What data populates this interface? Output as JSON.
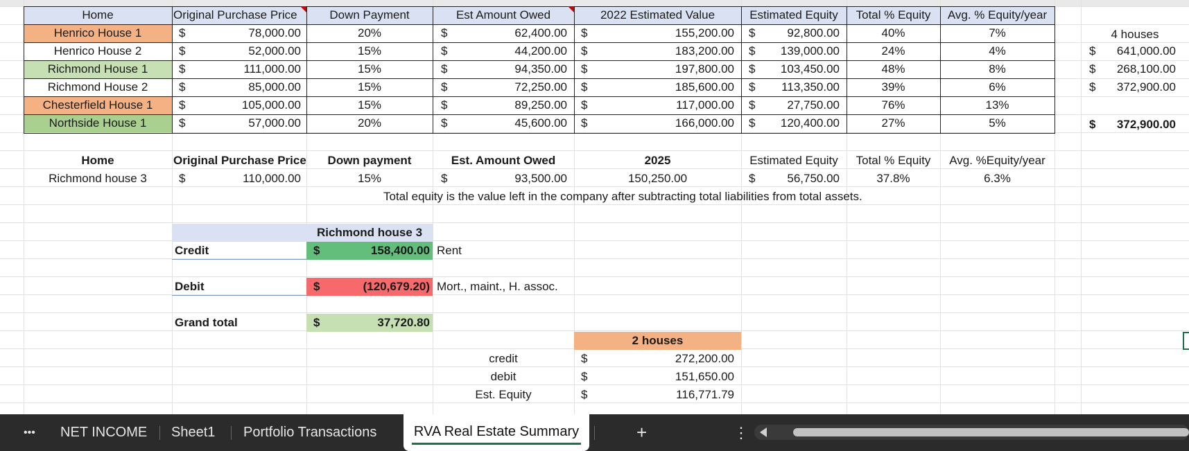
{
  "colors": {
    "header_blue": "#d9e1f2",
    "row_orange": "#f4b183",
    "row_lightgreen": "#c6e0b4",
    "row_green": "#a9d08e",
    "credit_green": "#63be7b",
    "debit_red": "#f8696b",
    "grand_green": "#c6e0b4",
    "tabbar_bg": "#2b2b2b",
    "active_tab_underline": "#1e7145"
  },
  "table1": {
    "headers": [
      "Home",
      "Original Purchase Price",
      "Down Payment",
      "Est Amount Owed",
      "2022 Estimated Value",
      "Estimated Equity",
      "Total % Equity",
      "Avg. % Equity/year"
    ],
    "rows": [
      {
        "home": "Henrico House 1",
        "price": "78,000.00",
        "down": "20%",
        "owed": "62,400.00",
        "value": "155,200.00",
        "equity": "92,800.00",
        "total_pct": "40%",
        "avg_pct": "7%"
      },
      {
        "home": "Henrico House 2",
        "price": "52,000.00",
        "down": "15%",
        "owed": "44,200.00",
        "value": "183,200.00",
        "equity": "139,000.00",
        "total_pct": "24%",
        "avg_pct": "4%"
      },
      {
        "home": "Richmond House 1",
        "price": "111,000.00",
        "down": "15%",
        "owed": "94,350.00",
        "value": "197,800.00",
        "equity": "103,450.00",
        "total_pct": "48%",
        "avg_pct": "8%"
      },
      {
        "home": "Richmond House 2",
        "price": "85,000.00",
        "down": "15%",
        "owed": "72,250.00",
        "value": "185,600.00",
        "equity": "113,350.00",
        "total_pct": "39%",
        "avg_pct": "6%"
      },
      {
        "home": "Chesterfield House 1",
        "price": "105,000.00",
        "down": "15%",
        "owed": "89,250.00",
        "value": "117,000.00",
        "equity": "27,750.00",
        "total_pct": "76%",
        "avg_pct": "13%"
      },
      {
        "home": "Northside House 1",
        "price": "57,000.00",
        "down": "20%",
        "owed": "45,600.00",
        "value": "166,000.00",
        "equity": "120,400.00",
        "total_pct": "27%",
        "avg_pct": "5%"
      }
    ]
  },
  "currency_symbol": "$",
  "side": {
    "label": "4 houses",
    "values": [
      "641,000.00",
      "268,100.00",
      "372,900.00"
    ],
    "total": "372,900.00"
  },
  "table2": {
    "headers": [
      "Home",
      "Original Purchase Price",
      "Down payment",
      "Est. Amount Owed",
      "2025",
      "Estimated Equity",
      "Total % Equity",
      "Avg. %Equity/year"
    ],
    "row": {
      "home": "Richmond house 3",
      "price": "110,000.00",
      "down": "15%",
      "owed": "93,500.00",
      "value": "150,250.00",
      "equity": "56,750.00",
      "total_pct": "37.8%",
      "avg_pct": "6.3%"
    },
    "note": "Total equity is the value left in the company after subtracting total liabilities from total assets."
  },
  "ledger": {
    "title": "Richmond house 3",
    "credit_label": "Credit",
    "credit_value": "158,400.00",
    "credit_note": "Rent",
    "debit_label": "Debit",
    "debit_value": "(120,679.20)",
    "debit_note": "Mort., maint., H. assoc.",
    "grand_label": "Grand total",
    "grand_value": "37,720.80"
  },
  "two_houses": {
    "title": "2 houses",
    "rows": [
      {
        "label": "credit",
        "value": "272,200.00"
      },
      {
        "label": "debit",
        "value": "151,650.00"
      },
      {
        "label": "Est. Equity",
        "value": "116,771.79"
      }
    ]
  },
  "tabs": {
    "more": "•••",
    "items": [
      "NET INCOME",
      "Sheet1",
      "Portfolio Transactions",
      "RVA Real Estate Summary"
    ],
    "add": "+",
    "menu": "⋮"
  }
}
